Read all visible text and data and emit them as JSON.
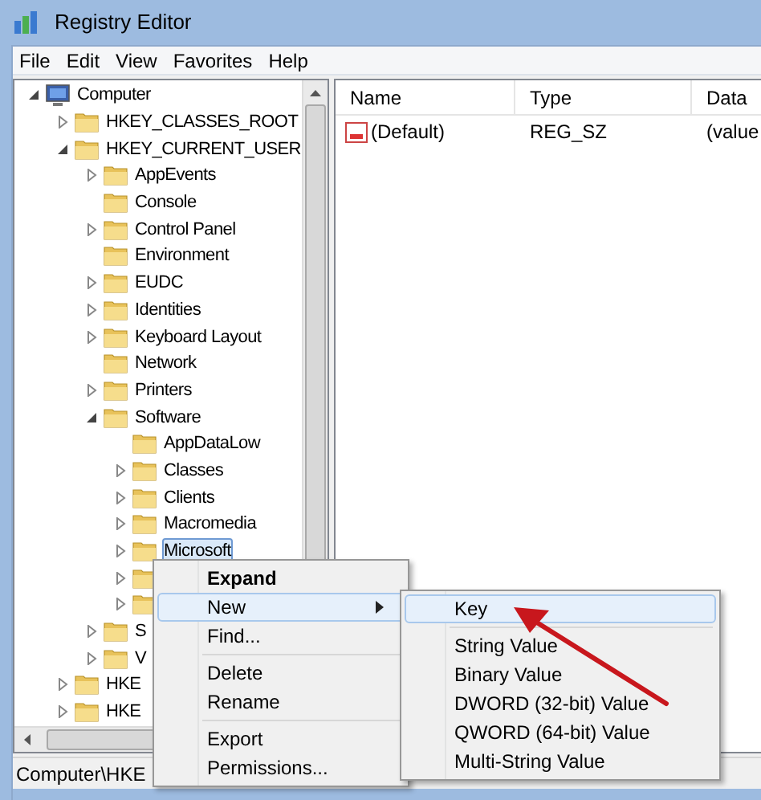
{
  "window": {
    "title": "Registry Editor"
  },
  "menu_bar": [
    "File",
    "Edit",
    "View",
    "Favorites",
    "Help"
  ],
  "tree": [
    {
      "label": "Computer",
      "kind": "computer",
      "expandable": true,
      "expanded": true,
      "selected": false,
      "children": [
        {
          "label": "HKEY_CLASSES_ROOT",
          "expandable": true,
          "expanded": false,
          "selected": false
        },
        {
          "label": "HKEY_CURRENT_USER",
          "expandable": true,
          "expanded": true,
          "selected": false,
          "children": [
            {
              "label": "AppEvents",
              "expandable": true,
              "expanded": false,
              "selected": false
            },
            {
              "label": "Console",
              "expandable": false,
              "selected": false
            },
            {
              "label": "Control Panel",
              "expandable": true,
              "expanded": false,
              "selected": false
            },
            {
              "label": "Environment",
              "expandable": false,
              "selected": false
            },
            {
              "label": "EUDC",
              "expandable": true,
              "expanded": false,
              "selected": false
            },
            {
              "label": "Identities",
              "expandable": true,
              "expanded": false,
              "selected": false
            },
            {
              "label": "Keyboard Layout",
              "expandable": true,
              "expanded": false,
              "selected": false
            },
            {
              "label": "Network",
              "expandable": false,
              "selected": false
            },
            {
              "label": "Printers",
              "expandable": true,
              "expanded": false,
              "selected": false
            },
            {
              "label": "Software",
              "expandable": true,
              "expanded": true,
              "selected": false,
              "children": [
                {
                  "label": "AppDataLow",
                  "expandable": false,
                  "selected": false
                },
                {
                  "label": "Classes",
                  "expandable": true,
                  "expanded": false,
                  "selected": false
                },
                {
                  "label": "Clients",
                  "expandable": true,
                  "expanded": false,
                  "selected": false
                },
                {
                  "label": "Macromedia",
                  "expandable": true,
                  "expanded": false,
                  "selected": false
                },
                {
                  "label": "Microsoft",
                  "expandable": true,
                  "expanded": false,
                  "selected": true
                },
                {
                  "expandable": true,
                  "expanded": false
                },
                {
                  "expandable": true,
                  "expanded": false
                }
              ]
            },
            {
              "label": "S",
              "expandable": true,
              "expanded": false,
              "selected": false
            },
            {
              "label": "V",
              "expandable": true,
              "expanded": false,
              "selected": false
            }
          ]
        },
        {
          "label": "HKE",
          "expandable": true,
          "expanded": false,
          "selected": false
        },
        {
          "label": "HKE",
          "expandable": true,
          "expanded": false,
          "selected": false
        }
      ]
    }
  ],
  "list": {
    "columns": [
      "Name",
      "Type",
      "Data"
    ],
    "rows": [
      {
        "name": "(Default)",
        "type": "REG_SZ",
        "data": "(value"
      }
    ]
  },
  "status_bar": "Computer\\HKE",
  "context_menu": [
    {
      "label": "Expand",
      "kind": "item",
      "bold": true,
      "highlighted": false
    },
    {
      "label": "New",
      "kind": "submenu",
      "bold": false,
      "highlighted": true
    },
    {
      "label": "Find...",
      "kind": "item",
      "bold": false,
      "highlighted": false
    },
    {
      "kind": "separator"
    },
    {
      "label": "Delete",
      "kind": "item",
      "bold": false,
      "highlighted": false
    },
    {
      "label": "Rename",
      "kind": "item",
      "bold": false,
      "highlighted": false
    },
    {
      "kind": "separator"
    },
    {
      "label": "Export",
      "kind": "item",
      "bold": false,
      "highlighted": false
    },
    {
      "label": "Permissions...",
      "kind": "item",
      "bold": false,
      "highlighted": false
    }
  ],
  "submenu": [
    {
      "label": "Key",
      "kind": "item",
      "highlighted": true
    },
    {
      "kind": "separator"
    },
    {
      "label": "String Value",
      "kind": "item",
      "highlighted": false
    },
    {
      "label": "Binary Value",
      "kind": "item",
      "highlighted": false
    },
    {
      "label": "DWORD (32-bit) Value",
      "kind": "item",
      "highlighted": false
    },
    {
      "label": "QWORD (64-bit) Value",
      "kind": "item",
      "highlighted": false
    },
    {
      "label": "Multi-String Value",
      "kind": "item",
      "highlighted": false
    }
  ]
}
